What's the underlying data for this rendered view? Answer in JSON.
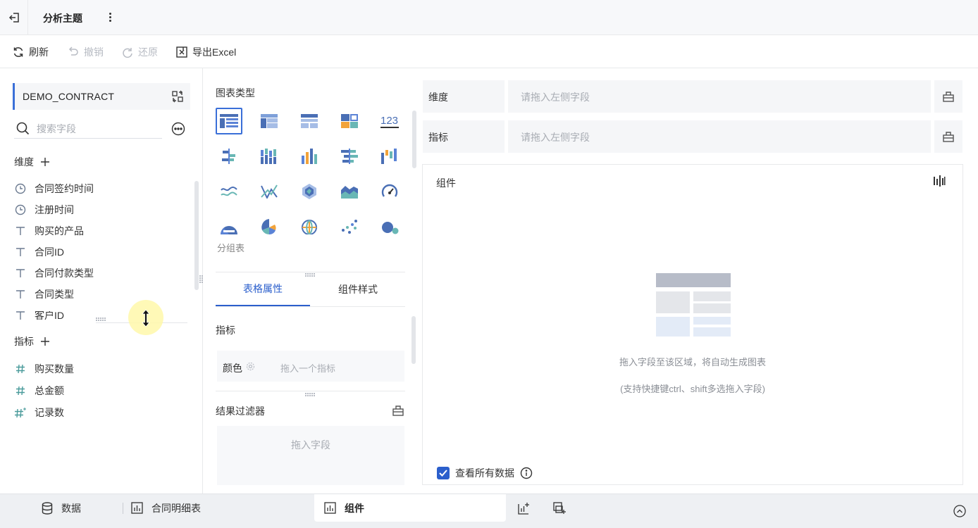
{
  "header": {
    "title": "分析主题",
    "back_icon": "exit-icon",
    "more_icon": "vertical-ellipsis-icon"
  },
  "toolbar": {
    "refresh": "刷新",
    "undo": "撤销",
    "redo": "还原",
    "export": "导出Excel"
  },
  "left_panel": {
    "dataset_name": "DEMO_CONTRACT",
    "search_placeholder": "搜索字段",
    "dimension_title": "维度",
    "dimensions": [
      {
        "icon": "clock-icon",
        "label": "合同签约时间"
      },
      {
        "icon": "clock-icon",
        "label": "注册时间"
      },
      {
        "icon": "text-type-icon",
        "label": "购买的产品"
      },
      {
        "icon": "text-type-icon",
        "label": "合同ID"
      },
      {
        "icon": "text-type-icon",
        "label": "合同付款类型"
      },
      {
        "icon": "text-type-icon",
        "label": "合同类型"
      },
      {
        "icon": "text-type-icon",
        "label": "客户ID"
      }
    ],
    "measure_title": "指标",
    "measures": [
      {
        "icon": "number-type-icon",
        "label": "购买数量"
      },
      {
        "icon": "number-type-icon",
        "label": "总金额"
      },
      {
        "icon": "record-count-icon",
        "label": "记录数"
      }
    ]
  },
  "middle_panel": {
    "chart_type_title": "图表类型",
    "chart_types": [
      "grouped-table-icon",
      "cross-table-icon",
      "detail-table-icon",
      "treemap-icon",
      "kpi-number-icon",
      "bar-chart-icon",
      "stacked-bar-icon",
      "column-chart-icon",
      "horizontal-bar-icon",
      "waterfall-icon",
      "line-chart-icon",
      "range-line-icon",
      "radar-chart-icon",
      "area-chart-icon",
      "gauge-icon",
      "pie-chart-icon",
      "rose-chart-icon",
      "map-icon",
      "scatter-icon",
      "bubble-icon"
    ],
    "selected_chart_type_name": "分组表",
    "tabs": [
      "表格属性",
      "组件样式"
    ],
    "active_tab": "表格属性",
    "indicator_label": "指标",
    "color_label": "颜色",
    "color_placeholder": "拖入一个指标",
    "filter_title": "结果过滤器",
    "filter_placeholder": "拖入字段"
  },
  "right_panel": {
    "dimension_slot_label": "维度",
    "dimension_slot_placeholder": "请拖入左侧字段",
    "measure_slot_label": "指标",
    "measure_slot_placeholder": "请拖入左侧字段",
    "component_title": "组件",
    "empty_hint": "拖入字段至该区域，将自动生成图表",
    "empty_sub_hint": "(支持快捷键ctrl、shift多选拖入字段)",
    "view_all_label": "查看所有数据",
    "view_all_checked": true
  },
  "bottom_tabs": {
    "data": "数据",
    "detail_table": "合同明细表",
    "component": "组件"
  },
  "colors": {
    "accent": "#2b5fcc",
    "icon_gray": "#6b7a90"
  }
}
